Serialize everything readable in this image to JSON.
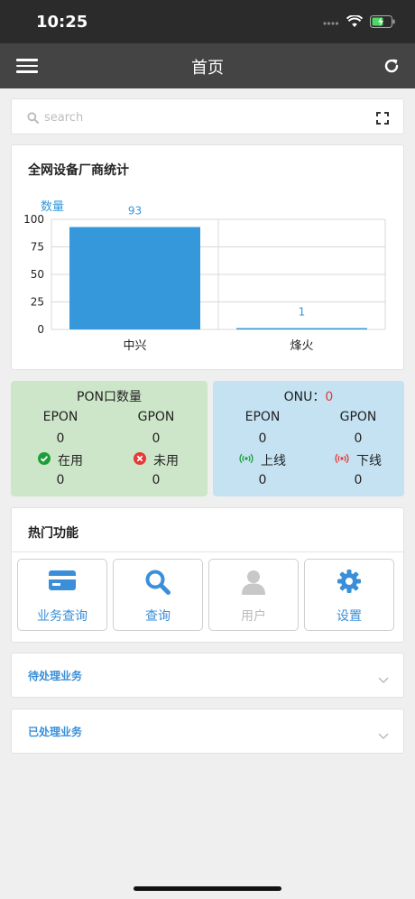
{
  "status_bar": {
    "time": "10:25"
  },
  "nav": {
    "title": "首页"
  },
  "search": {
    "placeholder": "search"
  },
  "vendor_chart": {
    "title": "全网设备厂商统计"
  },
  "chart_data": {
    "type": "bar",
    "title": "全网设备厂商统计",
    "ylabel": "数量",
    "xlabel": "",
    "categories": [
      "中兴",
      "烽火"
    ],
    "values": [
      93,
      1
    ],
    "ylim": [
      0,
      100
    ],
    "yticks": [
      0,
      25,
      50,
      75,
      100
    ],
    "grid": true,
    "bar_color": "#3498db",
    "label_color": "#3498db"
  },
  "pon": {
    "title": "PON口数量",
    "epon_label": "EPON",
    "gpon_label": "GPON",
    "epon_count": "0",
    "gpon_count": "0",
    "in_use_label": "在用",
    "unused_label": "未用",
    "in_use_count": "0",
    "unused_count": "0"
  },
  "onu": {
    "title": "ONU：",
    "total": "0",
    "epon_label": "EPON",
    "gpon_label": "GPON",
    "epon_count": "0",
    "gpon_count": "0",
    "online_label": "上线",
    "offline_label": "下线",
    "online_count": "0",
    "offline_count": "0"
  },
  "functions": {
    "title": "热门功能",
    "items": [
      {
        "label": "业务查询",
        "icon": "card-icon",
        "enabled": true
      },
      {
        "label": "查询",
        "icon": "search-icon",
        "enabled": true
      },
      {
        "label": "用户",
        "icon": "user-icon",
        "enabled": false
      },
      {
        "label": "设置",
        "icon": "gear-icon",
        "enabled": true
      }
    ]
  },
  "pending": {
    "label": "待处理业务"
  },
  "processed": {
    "label": "已处理业务"
  },
  "colors": {
    "nav_bg": "#444444",
    "accent": "#3a8fd8",
    "pon_bg": "#cde6c9",
    "onu_bg": "#c4e2f2",
    "red": "#e53935",
    "green": "#1e9e3a"
  }
}
